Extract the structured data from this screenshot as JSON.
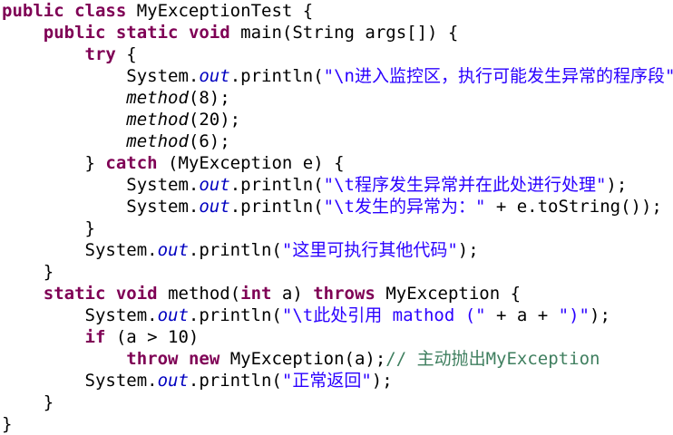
{
  "code": {
    "lines": [
      {
        "indent": "",
        "tokens": [
          {
            "t": "kw",
            "v": "public"
          },
          {
            "t": "p",
            "v": " "
          },
          {
            "t": "kw",
            "v": "class"
          },
          {
            "t": "p",
            "v": " MyExceptionTest {"
          }
        ]
      },
      {
        "indent": "    ",
        "tokens": [
          {
            "t": "kw",
            "v": "public"
          },
          {
            "t": "p",
            "v": " "
          },
          {
            "t": "kw",
            "v": "static"
          },
          {
            "t": "p",
            "v": " "
          },
          {
            "t": "kw",
            "v": "void"
          },
          {
            "t": "p",
            "v": " main(String args[]) {"
          }
        ]
      },
      {
        "indent": "        ",
        "tokens": [
          {
            "t": "kw",
            "v": "try"
          },
          {
            "t": "p",
            "v": " {"
          }
        ]
      },
      {
        "indent": "            ",
        "tokens": [
          {
            "t": "p",
            "v": "System."
          },
          {
            "t": "fld",
            "v": "out"
          },
          {
            "t": "p",
            "v": ".println("
          },
          {
            "t": "str",
            "v": "\"\\n进入监控区，执行可能发生异常的程序段\""
          },
          {
            "t": "p",
            "v": ");"
          }
        ]
      },
      {
        "indent": "            ",
        "tokens": [
          {
            "t": "ital",
            "v": "method"
          },
          {
            "t": "p",
            "v": "(8);"
          }
        ]
      },
      {
        "indent": "            ",
        "tokens": [
          {
            "t": "ital",
            "v": "method"
          },
          {
            "t": "p",
            "v": "(20);"
          }
        ]
      },
      {
        "indent": "            ",
        "tokens": [
          {
            "t": "ital",
            "v": "method"
          },
          {
            "t": "p",
            "v": "(6);"
          }
        ]
      },
      {
        "indent": "        ",
        "tokens": [
          {
            "t": "p",
            "v": "} "
          },
          {
            "t": "kw",
            "v": "catch"
          },
          {
            "t": "p",
            "v": " (MyException e) {"
          }
        ]
      },
      {
        "indent": "            ",
        "tokens": [
          {
            "t": "p",
            "v": "System."
          },
          {
            "t": "fld",
            "v": "out"
          },
          {
            "t": "p",
            "v": ".println("
          },
          {
            "t": "str",
            "v": "\"\\t程序发生异常并在此处进行处理\""
          },
          {
            "t": "p",
            "v": ");"
          }
        ]
      },
      {
        "indent": "            ",
        "tokens": [
          {
            "t": "p",
            "v": "System."
          },
          {
            "t": "fld",
            "v": "out"
          },
          {
            "t": "p",
            "v": ".println("
          },
          {
            "t": "str",
            "v": "\"\\t发生的异常为：\""
          },
          {
            "t": "p",
            "v": " + e.toString());"
          }
        ]
      },
      {
        "indent": "        ",
        "tokens": [
          {
            "t": "p",
            "v": "}"
          }
        ]
      },
      {
        "indent": "        ",
        "tokens": [
          {
            "t": "p",
            "v": "System."
          },
          {
            "t": "fld",
            "v": "out"
          },
          {
            "t": "p",
            "v": ".println("
          },
          {
            "t": "str",
            "v": "\"这里可执行其他代码\""
          },
          {
            "t": "p",
            "v": ");"
          }
        ]
      },
      {
        "indent": "    ",
        "tokens": [
          {
            "t": "p",
            "v": "}"
          }
        ]
      },
      {
        "indent": "    ",
        "tokens": [
          {
            "t": "kw",
            "v": "static"
          },
          {
            "t": "p",
            "v": " "
          },
          {
            "t": "kw",
            "v": "void"
          },
          {
            "t": "p",
            "v": " method("
          },
          {
            "t": "kw",
            "v": "int"
          },
          {
            "t": "p",
            "v": " a) "
          },
          {
            "t": "kw",
            "v": "throws"
          },
          {
            "t": "p",
            "v": " MyException {"
          }
        ]
      },
      {
        "indent": "        ",
        "tokens": [
          {
            "t": "p",
            "v": "System."
          },
          {
            "t": "fld",
            "v": "out"
          },
          {
            "t": "p",
            "v": ".println("
          },
          {
            "t": "str",
            "v": "\"\\t此处引用 mathod (\""
          },
          {
            "t": "p",
            "v": " + a + "
          },
          {
            "t": "str",
            "v": "\")\""
          },
          {
            "t": "p",
            "v": ");"
          }
        ]
      },
      {
        "indent": "        ",
        "tokens": [
          {
            "t": "kw",
            "v": "if"
          },
          {
            "t": "p",
            "v": " (a > 10)"
          }
        ]
      },
      {
        "indent": "            ",
        "tokens": [
          {
            "t": "kw",
            "v": "throw"
          },
          {
            "t": "p",
            "v": " "
          },
          {
            "t": "kw",
            "v": "new"
          },
          {
            "t": "p",
            "v": " MyException(a);"
          },
          {
            "t": "cmt",
            "v": "// 主动抛出MyException"
          }
        ]
      },
      {
        "indent": "        ",
        "tokens": [
          {
            "t": "p",
            "v": "System."
          },
          {
            "t": "fld",
            "v": "out"
          },
          {
            "t": "p",
            "v": ".println("
          },
          {
            "t": "str",
            "v": "\"正常返回\""
          },
          {
            "t": "p",
            "v": ");"
          }
        ]
      },
      {
        "indent": "    ",
        "tokens": [
          {
            "t": "p",
            "v": "}"
          }
        ]
      },
      {
        "indent": "",
        "tokens": [
          {
            "t": "p",
            "v": "}"
          }
        ]
      }
    ]
  },
  "colors": {
    "keyword": "#7f0055",
    "field": "#0000c0",
    "string": "#2a00ff",
    "comment": "#3f7f5f",
    "text": "#000000",
    "background": "#ffffff"
  }
}
